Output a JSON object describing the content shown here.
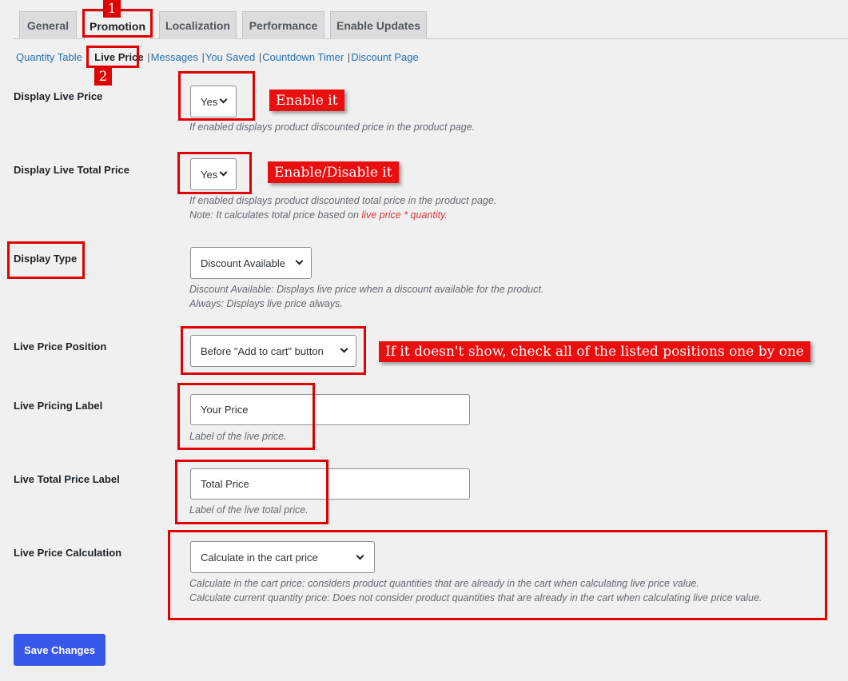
{
  "tabs": [
    "General",
    "Promotion",
    "Localization",
    "Performance",
    "Enable Updates"
  ],
  "subnav": [
    "Quantity Table",
    "Live Price",
    "Messages",
    "You Saved",
    "Countdown Timer",
    "Discount Page"
  ],
  "fields": {
    "display_live_price": {
      "label": "Display Live Price",
      "value": "Yes",
      "desc": "If enabled displays product discounted price in the product page."
    },
    "display_live_total_price": {
      "label": "Display Live Total Price",
      "value": "Yes",
      "desc1": "If enabled displays product discounted total price in the product page.",
      "desc2_prefix": "Note: It calculates total price based on ",
      "desc2_highlight": "live price * quantity."
    },
    "display_type": {
      "label": "Display Type",
      "value": "Discount Available",
      "desc1": "Discount Available: Displays live price when a discount available for the product.",
      "desc2": "Always: Displays live price always."
    },
    "live_price_position": {
      "label": "Live Price Position",
      "value": "Before \"Add to cart\" button"
    },
    "live_pricing_label": {
      "label": "Live Pricing Label",
      "value": "Your Price",
      "desc": "Label of the live price."
    },
    "live_total_price_label": {
      "label": "Live Total Price Label",
      "value": "Total Price",
      "desc": "Label of the live total price."
    },
    "live_price_calculation": {
      "label": "Live Price Calculation",
      "value": "Calculate in the cart price",
      "desc1": "Calculate in the cart price: considers product quantities that are already in the cart when calculating live price value.",
      "desc2": "Calculate current quantity price: Does not consider product quantities that are already in the cart when calculating live price value."
    }
  },
  "save_button": "Save Changes",
  "annotations": {
    "step1": "1",
    "step2": "2",
    "enable_it": "Enable it",
    "enable_disable_it": "Enable/Disable it",
    "position_tip": "If it doesn't show, check all of the listed positions one by one"
  },
  "colors": {
    "annotation_red": "#e00000",
    "button_blue": "#3858e9",
    "link_blue": "#2271b1"
  }
}
